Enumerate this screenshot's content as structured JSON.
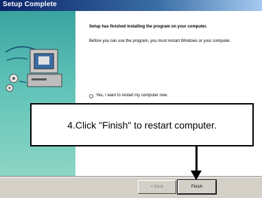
{
  "window": {
    "title": "Setup Complete"
  },
  "content": {
    "heading": "Setup has finished installing the program on your computer.",
    "body": "Before you can use the program, you must restart Windows or your computer.",
    "option_label": "Yes, I want to restart my computer now."
  },
  "buttons": {
    "back_label": "< Back",
    "finish_label": "Finish"
  },
  "annotation": {
    "text": "4.Click \"Finish\" to restart computer."
  },
  "icons": [
    "computer-illustration-icon",
    "arrow-down-icon"
  ],
  "colors": {
    "title_bar": "#0a246a",
    "panel_teal": "#5fc2b8",
    "dialog_gray": "#d4d0c8"
  }
}
